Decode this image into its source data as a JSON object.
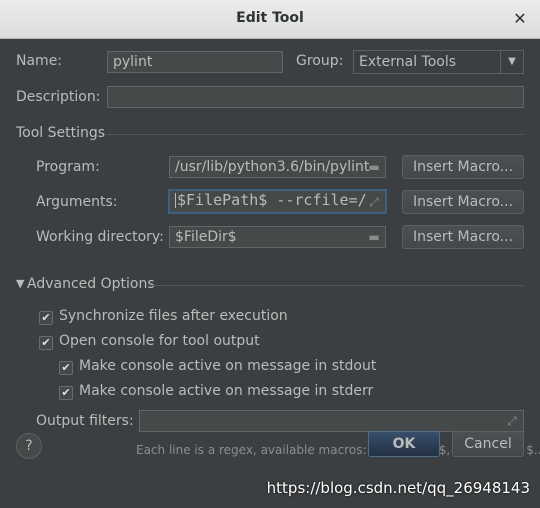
{
  "window": {
    "title": "Edit Tool",
    "close_glyph": "✕"
  },
  "name_label": "Name:",
  "name_value": "pylint",
  "group_label": "Group:",
  "group_value": "External Tools",
  "description_label": "Description:",
  "description_value": "",
  "tool_settings": {
    "title": "Tool Settings",
    "program_label": "Program:",
    "program_value": "/usr/lib/python3.6/bin/pylint",
    "arguments_label": "Arguments:",
    "arguments_value": "$FilePath$ --rcfile=/",
    "workdir_label": "Working directory:",
    "workdir_value": "$FileDir$",
    "insert_macro_label": "Insert Macro..."
  },
  "advanced": {
    "title": "Advanced Options",
    "options": [
      {
        "label": "Synchronize files after execution",
        "checked": true
      },
      {
        "label": "Open console for tool output",
        "checked": true
      },
      {
        "label": "Make console active on message in stdout",
        "checked": true
      },
      {
        "label": "Make console active on message in stderr",
        "checked": true
      }
    ],
    "output_filters_label": "Output filters:",
    "output_filters_value": "",
    "hint": "Each line is a regex, available macros: $FILE_PATH$, $LINE$ and $..."
  },
  "buttons": {
    "ok": "OK",
    "cancel": "Cancel",
    "help": "?"
  },
  "watermark": "https://blog.csdn.net/qq_26948143"
}
